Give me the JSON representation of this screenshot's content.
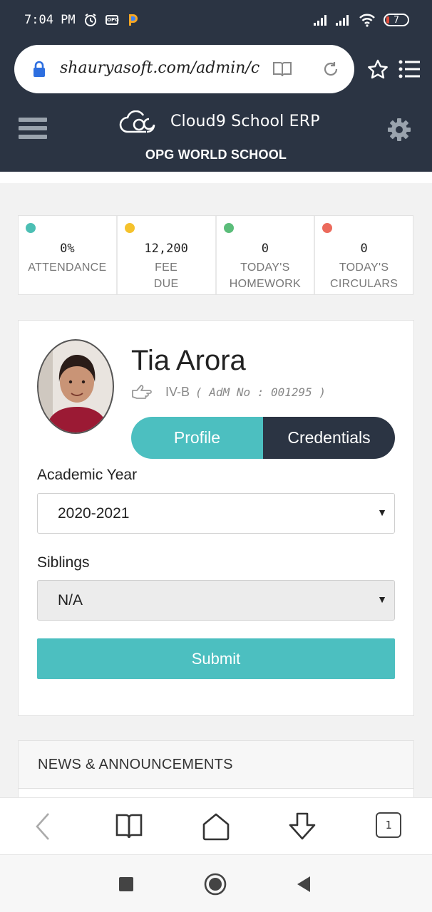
{
  "status_bar": {
    "time": "7:04 PM",
    "battery": "7"
  },
  "browser": {
    "url": "shauryasoft.com/admin/c"
  },
  "app_header": {
    "title": "Cloud9 School ERP",
    "school": "OPG WORLD SCHOOL"
  },
  "stats": [
    {
      "value": "0%",
      "label_line1": "ATTENDANCE",
      "label_line2": "",
      "color": "#4cbfb4"
    },
    {
      "value": "12,200",
      "label_line1": "FEE",
      "label_line2": "DUE",
      "color": "#f5c22c"
    },
    {
      "value": "0",
      "label_line1": "TODAY'S",
      "label_line2": "HOMEWORK",
      "color": "#5bbd7a"
    },
    {
      "value": "0",
      "label_line1": "TODAY'S",
      "label_line2": "CIRCULARS",
      "color": "#ec6a5c"
    }
  ],
  "profile": {
    "name": "Tia Arora",
    "class": "IV-B",
    "adm_no": "( AdM No : 001295 )",
    "tabs": {
      "profile": "Profile",
      "credentials": "Credentials"
    },
    "academic_year_label": "Academic Year",
    "academic_year_value": "2020-2021",
    "siblings_label": "Siblings",
    "siblings_value": "N/A",
    "submit_label": "Submit"
  },
  "news": {
    "title": "NEWS & ANNOUNCEMENTS"
  },
  "browser_toolbar": {
    "tab_count": "1"
  },
  "colors": {
    "header_bg": "#2b3443",
    "accent_teal": "#4cbfc0"
  }
}
